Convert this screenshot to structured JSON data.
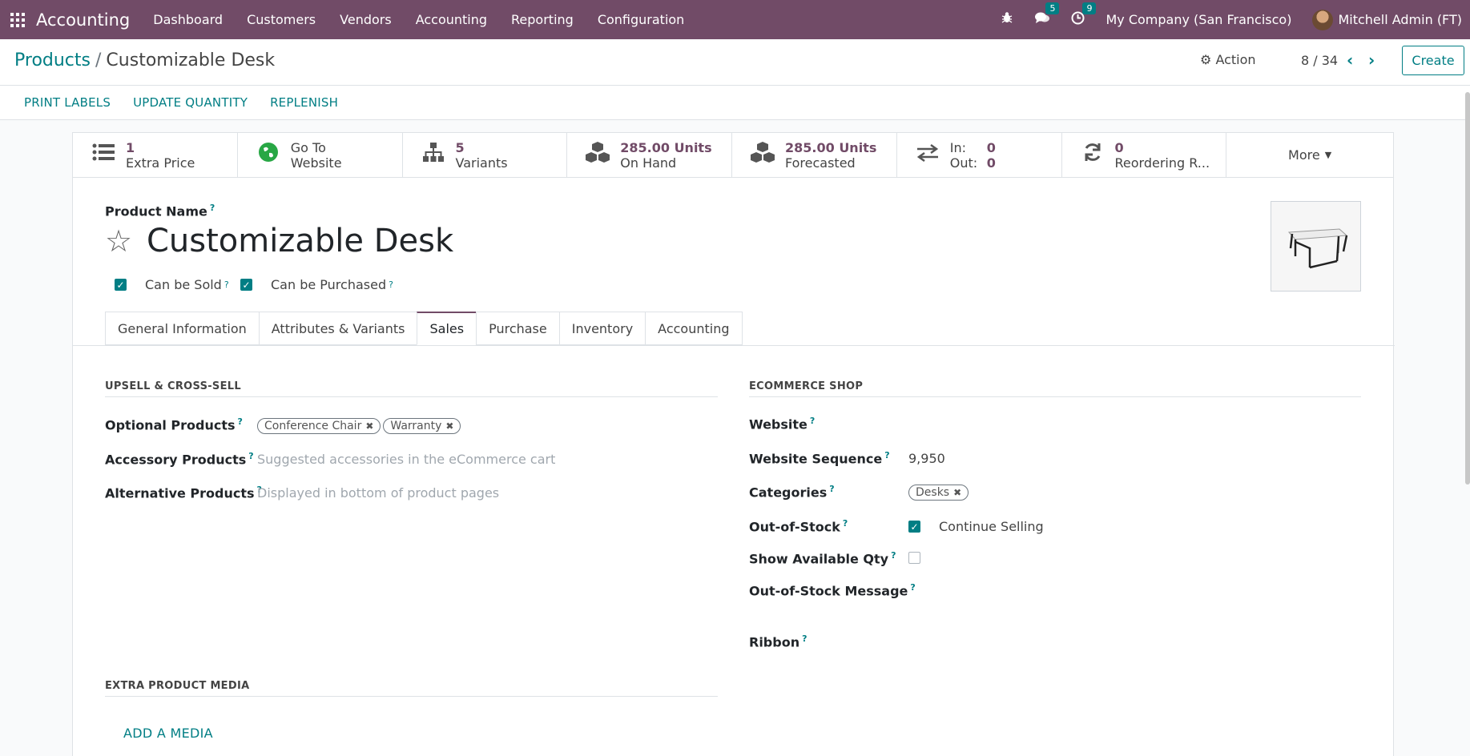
{
  "navbar": {
    "brand": "Accounting",
    "menu": [
      "Dashboard",
      "Customers",
      "Vendors",
      "Accounting",
      "Reporting",
      "Configuration"
    ],
    "chat_count": "5",
    "activity_count": "9",
    "company": "My Company (San Francisco)",
    "user": "Mitchell Admin (FT)"
  },
  "breadcrumb": {
    "parent": "Products",
    "separator": "/",
    "current": "Customizable Desk"
  },
  "control": {
    "action_label": "Action",
    "pager": "8 / 34",
    "create_label": "Create"
  },
  "statusbar": {
    "print_labels": "PRINT LABELS",
    "update_quantity": "UPDATE QUANTITY",
    "replenish": "REPLENISH"
  },
  "smart_buttons": {
    "extra_price": {
      "value": "1",
      "label": "Extra Price"
    },
    "website": {
      "line1": "Go To",
      "line2": "Website"
    },
    "variants": {
      "value": "5",
      "label": "Variants"
    },
    "on_hand": {
      "value": "285.00 Units",
      "label": "On Hand"
    },
    "forecasted": {
      "value": "285.00 Units",
      "label": "Forecasted"
    },
    "in_out": {
      "in_label": "In:",
      "in_value": "0",
      "out_label": "Out:",
      "out_value": "0"
    },
    "reordering": {
      "value": "0",
      "label": "Reordering R..."
    },
    "more": "More"
  },
  "product": {
    "name_label": "Product Name",
    "help_mark": "?",
    "name": "Customizable Desk",
    "can_be_sold": "Can be Sold",
    "can_be_purchased": "Can be Purchased"
  },
  "tabs": [
    "General Information",
    "Attributes & Variants",
    "Sales",
    "Purchase",
    "Inventory",
    "Accounting"
  ],
  "upsell": {
    "title": "UPSELL & CROSS-SELL",
    "optional_label": "Optional Products",
    "optional_tags": [
      "Conference Chair",
      "Warranty"
    ],
    "accessory_label": "Accessory Products",
    "accessory_placeholder": "Suggested accessories in the eCommerce cart",
    "alternative_label": "Alternative Products",
    "alternative_placeholder": "Displayed in bottom of product pages"
  },
  "ecommerce": {
    "title": "ECOMMERCE SHOP",
    "website_label": "Website",
    "sequence_label": "Website Sequence",
    "sequence_value": "9,950",
    "categories_label": "Categories",
    "category_tag": "Desks",
    "oos_label": "Out-of-Stock",
    "continue_selling": "Continue Selling",
    "show_qty_label": "Show Available Qty",
    "oos_message_label": "Out-of-Stock Message",
    "ribbon_label": "Ribbon"
  },
  "media": {
    "title": "EXTRA PRODUCT MEDIA",
    "add_label": "ADD A MEDIA"
  }
}
